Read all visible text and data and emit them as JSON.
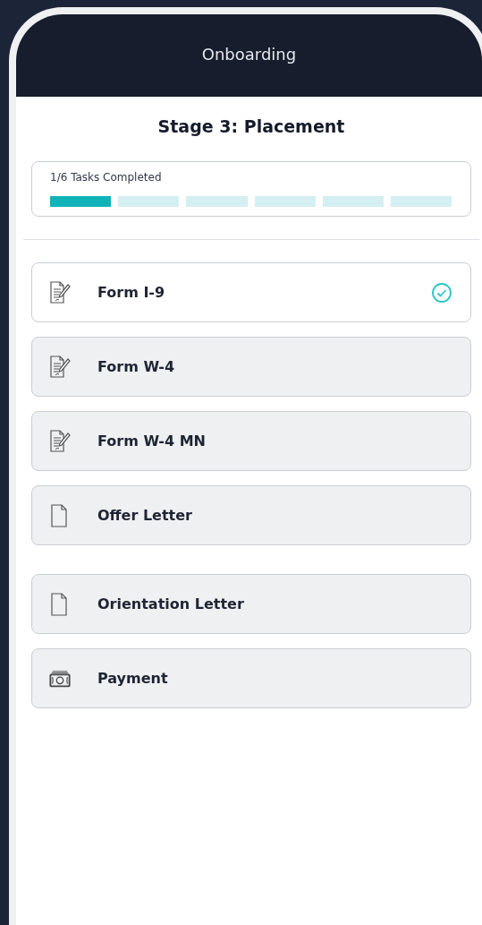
{
  "header": {
    "title": "Onboarding"
  },
  "stage": {
    "title": "Stage 3: Placement"
  },
  "progress": {
    "label": "1/6 Tasks Completed",
    "segments": [
      {
        "done": true
      },
      {
        "done": false
      },
      {
        "done": false
      },
      {
        "done": false
      },
      {
        "done": false
      },
      {
        "done": false
      }
    ]
  },
  "task_groups": [
    [
      {
        "kind": "form",
        "label": "Form I-9",
        "completed": true
      },
      {
        "kind": "form",
        "label": "Form W-4",
        "completed": false
      },
      {
        "kind": "form",
        "label": "Form W-4 MN",
        "completed": false
      },
      {
        "kind": "document",
        "label": "Offer Letter",
        "completed": false
      }
    ],
    [
      {
        "kind": "document",
        "label": "Orientation Letter",
        "completed": false
      },
      {
        "kind": "payment",
        "label": "Payment",
        "completed": false
      }
    ]
  ]
}
